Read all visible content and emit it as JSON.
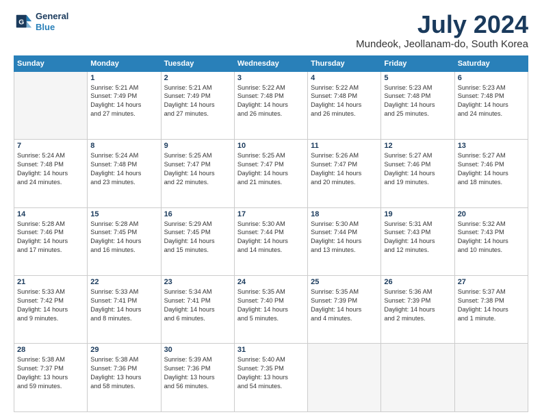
{
  "logo": {
    "line1": "General",
    "line2": "Blue",
    "alt": "GeneralBlue logo"
  },
  "title": "July 2024",
  "location": "Mundeok, Jeollanam-do, South Korea",
  "headers": [
    "Sunday",
    "Monday",
    "Tuesday",
    "Wednesday",
    "Thursday",
    "Friday",
    "Saturday"
  ],
  "weeks": [
    [
      {
        "day": "",
        "sunrise": "",
        "sunset": "",
        "daylight": "",
        "empty": true
      },
      {
        "day": "1",
        "sunrise": "Sunrise: 5:21 AM",
        "sunset": "Sunset: 7:49 PM",
        "daylight": "Daylight: 14 hours and 27 minutes."
      },
      {
        "day": "2",
        "sunrise": "Sunrise: 5:21 AM",
        "sunset": "Sunset: 7:49 PM",
        "daylight": "Daylight: 14 hours and 27 minutes."
      },
      {
        "day": "3",
        "sunrise": "Sunrise: 5:22 AM",
        "sunset": "Sunset: 7:48 PM",
        "daylight": "Daylight: 14 hours and 26 minutes."
      },
      {
        "day": "4",
        "sunrise": "Sunrise: 5:22 AM",
        "sunset": "Sunset: 7:48 PM",
        "daylight": "Daylight: 14 hours and 26 minutes."
      },
      {
        "day": "5",
        "sunrise": "Sunrise: 5:23 AM",
        "sunset": "Sunset: 7:48 PM",
        "daylight": "Daylight: 14 hours and 25 minutes."
      },
      {
        "day": "6",
        "sunrise": "Sunrise: 5:23 AM",
        "sunset": "Sunset: 7:48 PM",
        "daylight": "Daylight: 14 hours and 24 minutes."
      }
    ],
    [
      {
        "day": "7",
        "sunrise": "Sunrise: 5:24 AM",
        "sunset": "Sunset: 7:48 PM",
        "daylight": "Daylight: 14 hours and 24 minutes."
      },
      {
        "day": "8",
        "sunrise": "Sunrise: 5:24 AM",
        "sunset": "Sunset: 7:48 PM",
        "daylight": "Daylight: 14 hours and 23 minutes."
      },
      {
        "day": "9",
        "sunrise": "Sunrise: 5:25 AM",
        "sunset": "Sunset: 7:47 PM",
        "daylight": "Daylight: 14 hours and 22 minutes."
      },
      {
        "day": "10",
        "sunrise": "Sunrise: 5:25 AM",
        "sunset": "Sunset: 7:47 PM",
        "daylight": "Daylight: 14 hours and 21 minutes."
      },
      {
        "day": "11",
        "sunrise": "Sunrise: 5:26 AM",
        "sunset": "Sunset: 7:47 PM",
        "daylight": "Daylight: 14 hours and 20 minutes."
      },
      {
        "day": "12",
        "sunrise": "Sunrise: 5:27 AM",
        "sunset": "Sunset: 7:46 PM",
        "daylight": "Daylight: 14 hours and 19 minutes."
      },
      {
        "day": "13",
        "sunrise": "Sunrise: 5:27 AM",
        "sunset": "Sunset: 7:46 PM",
        "daylight": "Daylight: 14 hours and 18 minutes."
      }
    ],
    [
      {
        "day": "14",
        "sunrise": "Sunrise: 5:28 AM",
        "sunset": "Sunset: 7:46 PM",
        "daylight": "Daylight: 14 hours and 17 minutes."
      },
      {
        "day": "15",
        "sunrise": "Sunrise: 5:28 AM",
        "sunset": "Sunset: 7:45 PM",
        "daylight": "Daylight: 14 hours and 16 minutes."
      },
      {
        "day": "16",
        "sunrise": "Sunrise: 5:29 AM",
        "sunset": "Sunset: 7:45 PM",
        "daylight": "Daylight: 14 hours and 15 minutes."
      },
      {
        "day": "17",
        "sunrise": "Sunrise: 5:30 AM",
        "sunset": "Sunset: 7:44 PM",
        "daylight": "Daylight: 14 hours and 14 minutes."
      },
      {
        "day": "18",
        "sunrise": "Sunrise: 5:30 AM",
        "sunset": "Sunset: 7:44 PM",
        "daylight": "Daylight: 14 hours and 13 minutes."
      },
      {
        "day": "19",
        "sunrise": "Sunrise: 5:31 AM",
        "sunset": "Sunset: 7:43 PM",
        "daylight": "Daylight: 14 hours and 12 minutes."
      },
      {
        "day": "20",
        "sunrise": "Sunrise: 5:32 AM",
        "sunset": "Sunset: 7:43 PM",
        "daylight": "Daylight: 14 hours and 10 minutes."
      }
    ],
    [
      {
        "day": "21",
        "sunrise": "Sunrise: 5:33 AM",
        "sunset": "Sunset: 7:42 PM",
        "daylight": "Daylight: 14 hours and 9 minutes."
      },
      {
        "day": "22",
        "sunrise": "Sunrise: 5:33 AM",
        "sunset": "Sunset: 7:41 PM",
        "daylight": "Daylight: 14 hours and 8 minutes."
      },
      {
        "day": "23",
        "sunrise": "Sunrise: 5:34 AM",
        "sunset": "Sunset: 7:41 PM",
        "daylight": "Daylight: 14 hours and 6 minutes."
      },
      {
        "day": "24",
        "sunrise": "Sunrise: 5:35 AM",
        "sunset": "Sunset: 7:40 PM",
        "daylight": "Daylight: 14 hours and 5 minutes."
      },
      {
        "day": "25",
        "sunrise": "Sunrise: 5:35 AM",
        "sunset": "Sunset: 7:39 PM",
        "daylight": "Daylight: 14 hours and 4 minutes."
      },
      {
        "day": "26",
        "sunrise": "Sunrise: 5:36 AM",
        "sunset": "Sunset: 7:39 PM",
        "daylight": "Daylight: 14 hours and 2 minutes."
      },
      {
        "day": "27",
        "sunrise": "Sunrise: 5:37 AM",
        "sunset": "Sunset: 7:38 PM",
        "daylight": "Daylight: 14 hours and 1 minute."
      }
    ],
    [
      {
        "day": "28",
        "sunrise": "Sunrise: 5:38 AM",
        "sunset": "Sunset: 7:37 PM",
        "daylight": "Daylight: 13 hours and 59 minutes."
      },
      {
        "day": "29",
        "sunrise": "Sunrise: 5:38 AM",
        "sunset": "Sunset: 7:36 PM",
        "daylight": "Daylight: 13 hours and 58 minutes."
      },
      {
        "day": "30",
        "sunrise": "Sunrise: 5:39 AM",
        "sunset": "Sunset: 7:36 PM",
        "daylight": "Daylight: 13 hours and 56 minutes."
      },
      {
        "day": "31",
        "sunrise": "Sunrise: 5:40 AM",
        "sunset": "Sunset: 7:35 PM",
        "daylight": "Daylight: 13 hours and 54 minutes."
      },
      {
        "day": "",
        "sunrise": "",
        "sunset": "",
        "daylight": "",
        "empty": true
      },
      {
        "day": "",
        "sunrise": "",
        "sunset": "",
        "daylight": "",
        "empty": true
      },
      {
        "day": "",
        "sunrise": "",
        "sunset": "",
        "daylight": "",
        "empty": true
      }
    ]
  ]
}
